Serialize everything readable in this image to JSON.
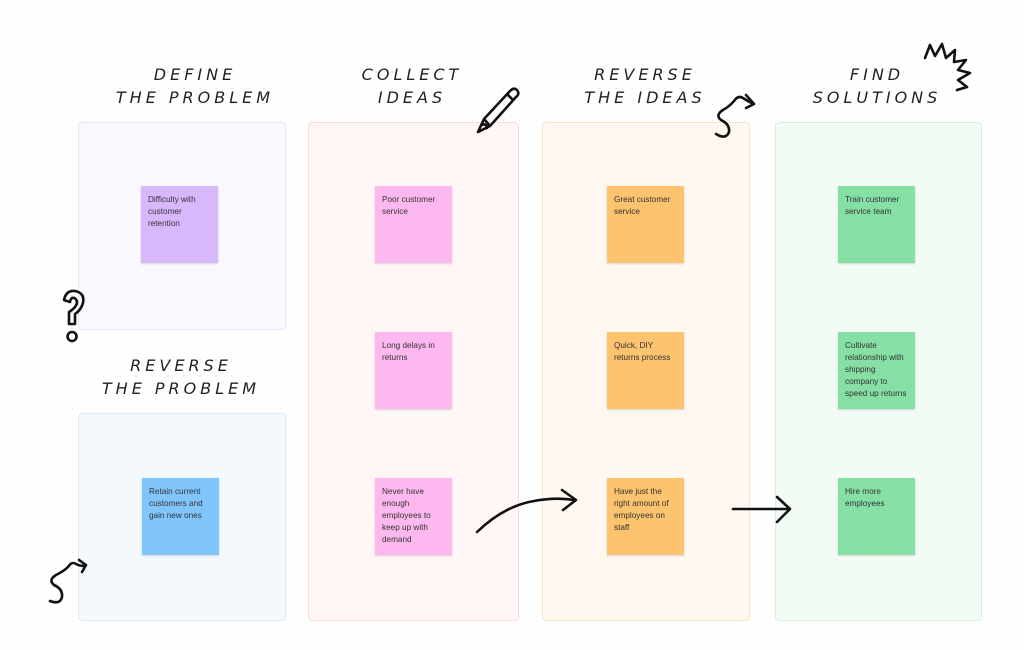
{
  "columns": [
    {
      "id": "define",
      "title": "Define\nthe problem",
      "notes": [
        "Difficulty with customer retention"
      ],
      "note_color": "#d8b8fc",
      "box_bg": "#faf7fe",
      "box_border": "#ece4f8"
    },
    {
      "id": "reverse-problem",
      "title": "Reverse\nthe problem",
      "notes": [
        "Retain current customers and gain new ones"
      ],
      "note_color": "#80c6fd",
      "box_bg": "#f4f9fe",
      "box_border": "#dcebf8"
    },
    {
      "id": "collect",
      "title": "Collect\nideas",
      "notes": [
        "Poor customer service",
        "Long delays in returns",
        "Never have enough employees to keep up with demand"
      ],
      "note_color": "#fdb9ef",
      "box_bg": "#fff6f5",
      "box_border": "#f9dcd8"
    },
    {
      "id": "reverse-ideas",
      "title": "Reverse\nthe ideas",
      "notes": [
        "Great customer service",
        "Quick, DIY returns process",
        "Have just the right amount of employees on staff"
      ],
      "note_color": "#fdc36e",
      "box_bg": "#fef8f0",
      "box_border": "#f7e5cd"
    },
    {
      "id": "find",
      "title": "Find\nsolutions",
      "notes": [
        "Train customer service team",
        "Cultivate relationship with shipping company to speed up returns",
        "Hire more employees"
      ],
      "note_color": "#86e0a5",
      "box_bg": "#f2fbf4",
      "box_border": "#d5f0dc"
    }
  ],
  "decorations": [
    "pencil-icon",
    "question-mark-icon",
    "squiggle-arrow-icon",
    "zigzag-icon",
    "curved-arrow-icon",
    "straight-arrow-icon"
  ]
}
